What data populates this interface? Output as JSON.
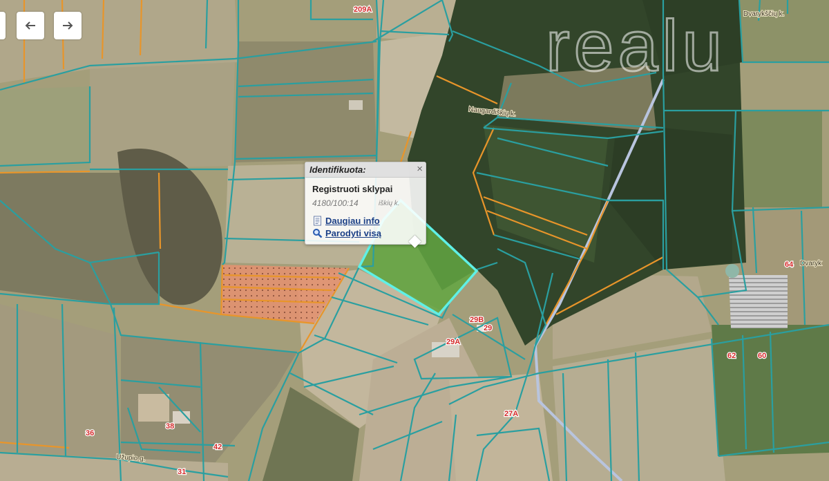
{
  "map": {
    "parcel_labels": [
      "209A",
      "29B",
      "29",
      "29A",
      "27A",
      "64",
      "62",
      "60",
      "38",
      "36",
      "42",
      "31"
    ],
    "village_labels": [
      "Dvarykščių k.",
      "Naugardiškių k.",
      "Dvaryk"
    ],
    "street_label": "Užupio g.",
    "watermark": "realu",
    "colors": {
      "parcel_line": "#2a9fa0",
      "orange_line": "#e8952a",
      "highlight": "#5ff0e6",
      "road": "#b8c4de"
    }
  },
  "nav": {
    "back_icon": "arrow-left-icon",
    "forward_icon": "arrow-right-icon"
  },
  "popup": {
    "title": "Identifikuota:",
    "close_symbol": "×",
    "section": "Registruoti sklypai",
    "parcel_id": "4180/100:14",
    "parcel_id_rest": "iškių k.",
    "link_info": "Daugiau info",
    "link_show": "Parodyti visą"
  }
}
